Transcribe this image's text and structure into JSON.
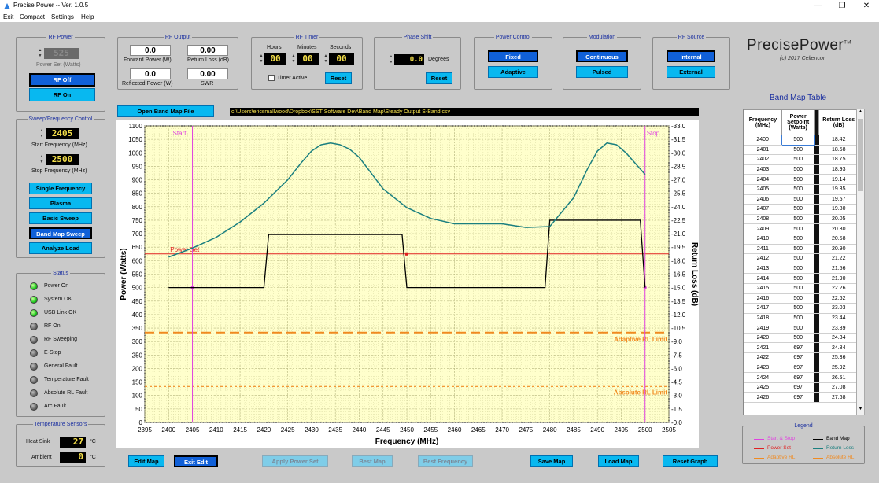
{
  "window": {
    "title": "Precise Power -- Ver. 1.0.5",
    "minimize": "—",
    "restore": "❐",
    "close": "✕"
  },
  "menu": [
    "Exit",
    "Compact",
    "Settings",
    "Help"
  ],
  "rf_power": {
    "title": "RF Power",
    "value": "525",
    "label": "Power Set (Watts)",
    "off": "RF Off",
    "on": "RF On"
  },
  "rf_output": {
    "title": "RF Output",
    "forward": "0.0",
    "forward_label": "Forward Power (W)",
    "return_loss": "0.00",
    "return_loss_label": "Return Loss (dB)",
    "reflected": "0.0",
    "reflected_label": "Reflected Power (W)",
    "swr": "0.00",
    "swr_label": "SWR"
  },
  "rf_timer": {
    "title": "RF Timer",
    "hours_label": "Hours",
    "minutes_label": "Minutes",
    "seconds_label": "Seconds",
    "hours": "00",
    "minutes": "00",
    "seconds": "00",
    "active_label": "Timer Active",
    "reset": "Reset"
  },
  "phase_shift": {
    "title": "Phase Shift",
    "value": "0.0",
    "unit": "Degrees",
    "reset": "Reset"
  },
  "power_control": {
    "title": "Power Control",
    "fixed": "Fixed",
    "adaptive": "Adaptive"
  },
  "modulation": {
    "title": "Modulation",
    "continuous": "Continuous",
    "pulsed": "Pulsed"
  },
  "rf_source": {
    "title": "RF Source",
    "internal": "Internal",
    "external": "External"
  },
  "brand": {
    "name": "PrecisePower",
    "tm": "TM",
    "copyright": "(c)  2017 Cellencor"
  },
  "sweep": {
    "title": "Sweep/Frequency Control",
    "start": "2405",
    "start_label": "Start Frequency (MHz)",
    "stop": "2500",
    "stop_label": "Stop Frequency (MHz)",
    "modes": [
      "Single Frequency",
      "Plasma",
      "Basic Sweep",
      "Band Map Sweep",
      "Analyze Load"
    ],
    "selected": 3
  },
  "status": {
    "title": "Status",
    "items": [
      {
        "label": "Power On",
        "on": true
      },
      {
        "label": "System OK",
        "on": true
      },
      {
        "label": "USB Link OK",
        "on": true
      },
      {
        "label": "RF On",
        "on": false
      },
      {
        "label": "RF Sweeping",
        "on": false
      },
      {
        "label": "E-Stop",
        "on": false
      },
      {
        "label": "General Fault",
        "on": false
      },
      {
        "label": "Temperature Fault",
        "on": false
      },
      {
        "label": "Absolute RL Fault",
        "on": false
      },
      {
        "label": "Arc Fault",
        "on": false
      }
    ]
  },
  "temperature": {
    "title": "Temperature Sensors",
    "heat_sink_label": "Heat Sink",
    "heat_sink": "27",
    "ambient_label": "Ambient",
    "ambient": "0",
    "unit": "°C"
  },
  "band_map": {
    "open_button": "Open Band Map File",
    "path": "c:\\Users\\ericsmallwood\\Dropbox\\SST Software Dev\\Band Map\\Steady Output S-Band.csv"
  },
  "bottom_buttons": [
    {
      "label": "Edit Map",
      "enabled": true,
      "selected": false
    },
    {
      "label": "Exit Edit",
      "enabled": true,
      "selected": true
    },
    {
      "label": "Apply Power Set",
      "enabled": false,
      "selected": false
    },
    {
      "label": "Best Map",
      "enabled": false,
      "selected": false
    },
    {
      "label": "Best Frequency",
      "enabled": false,
      "selected": false
    },
    {
      "label": "Save Map",
      "enabled": true,
      "selected": false
    },
    {
      "label": "Load Map",
      "enabled": true,
      "selected": false
    },
    {
      "label": "Reset Graph",
      "enabled": true,
      "selected": false
    }
  ],
  "table": {
    "title": "Band Map Table",
    "headers": [
      "Frequency (MHz)",
      "Power Setpoint (Watts)",
      "Return Loss (dB)"
    ],
    "rows": [
      [
        "2400",
        "500",
        "18.42"
      ],
      [
        "2401",
        "500",
        "18.58"
      ],
      [
        "2402",
        "500",
        "18.75"
      ],
      [
        "2403",
        "500",
        "18.93"
      ],
      [
        "2404",
        "500",
        "19.14"
      ],
      [
        "2405",
        "500",
        "19.35"
      ],
      [
        "2406",
        "500",
        "19.57"
      ],
      [
        "2407",
        "500",
        "19.80"
      ],
      [
        "2408",
        "500",
        "20.05"
      ],
      [
        "2409",
        "500",
        "20.30"
      ],
      [
        "2410",
        "500",
        "20.58"
      ],
      [
        "2411",
        "500",
        "20.90"
      ],
      [
        "2412",
        "500",
        "21.22"
      ],
      [
        "2413",
        "500",
        "21.56"
      ],
      [
        "2414",
        "500",
        "21.90"
      ],
      [
        "2415",
        "500",
        "22.26"
      ],
      [
        "2416",
        "500",
        "22.62"
      ],
      [
        "2417",
        "500",
        "23.03"
      ],
      [
        "2418",
        "500",
        "23.44"
      ],
      [
        "2419",
        "500",
        "23.89"
      ],
      [
        "2420",
        "500",
        "24.34"
      ],
      [
        "2421",
        "697",
        "24.84"
      ],
      [
        "2422",
        "697",
        "25.36"
      ],
      [
        "2423",
        "697",
        "25.92"
      ],
      [
        "2424",
        "697",
        "26.51"
      ],
      [
        "2425",
        "697",
        "27.08"
      ],
      [
        "2426",
        "697",
        "27.68"
      ]
    ]
  },
  "legend": {
    "title": "Legend",
    "items": [
      {
        "label": "Start & Stop",
        "color": "#e040e0"
      },
      {
        "label": "Band Map",
        "color": "#000000"
      },
      {
        "label": "Power Set",
        "color": "#e02020"
      },
      {
        "label": "Return Loss",
        "color": "#1a7f7f"
      },
      {
        "label": "Adaptive RL",
        "color": "#f08a20"
      },
      {
        "label": "Absolute RL",
        "color": "#f08a20"
      }
    ]
  },
  "chart_data": {
    "type": "line",
    "xlabel": "Frequency (MHz)",
    "ylabel": "Power (Watts)",
    "y2label": "Return Loss (dB)",
    "xlim": [
      2395,
      2505
    ],
    "ylim": [
      0,
      1100
    ],
    "y2lim": [
      0,
      33
    ],
    "xticks": [
      2395,
      2400,
      2405,
      2410,
      2415,
      2420,
      2425,
      2430,
      2435,
      2440,
      2445,
      2450,
      2455,
      2460,
      2465,
      2470,
      2475,
      2480,
      2485,
      2490,
      2495,
      2500,
      2505
    ],
    "yticks": [
      0,
      50,
      100,
      150,
      200,
      250,
      300,
      350,
      400,
      450,
      500,
      550,
      600,
      650,
      700,
      750,
      800,
      850,
      900,
      950,
      1000,
      1050,
      1100
    ],
    "y2ticks": [
      "-0.0",
      "-1.5",
      "-3.0",
      "-4.5",
      "-6.0",
      "-7.5",
      "-9.0",
      "-10.5",
      "-12.0",
      "-13.5",
      "-15.0",
      "-16.5",
      "-18.0",
      "-19.5",
      "-21.0",
      "-22.5",
      "-24.0",
      "-25.5",
      "-27.0",
      "-28.5",
      "-30.0",
      "-31.5",
      "-33.0"
    ],
    "grid": true,
    "start": {
      "x": 2405,
      "label": "Start"
    },
    "stop": {
      "x": 2500,
      "label": "Stop"
    },
    "power_set": {
      "y": 625,
      "label": "Power Set",
      "marker_x": 2450
    },
    "adaptive_rl": {
      "y": 10,
      "label": "Adaptive RL Limit"
    },
    "absolute_rl": {
      "y": 4,
      "label": "Absolute RL Limit"
    },
    "band_map": {
      "name": "Band Map",
      "x": [
        2400,
        2420,
        2421,
        2449,
        2450,
        2479,
        2480,
        2499,
        2500
      ],
      "y": [
        500,
        500,
        697,
        697,
        500,
        500,
        750,
        750,
        500
      ]
    },
    "return_loss": {
      "name": "Return Loss",
      "x": [
        2400,
        2405,
        2410,
        2415,
        2420,
        2425,
        2428,
        2430,
        2432,
        2434,
        2436,
        2438,
        2440,
        2442,
        2445,
        2450,
        2455,
        2460,
        2465,
        2470,
        2475,
        2480,
        2485,
        2488,
        2490,
        2492,
        2494,
        2496,
        2498,
        2500
      ],
      "y": [
        18.4,
        19.4,
        20.6,
        22.3,
        24.4,
        27.0,
        29.0,
        30.2,
        30.9,
        31.1,
        30.9,
        30.4,
        29.5,
        28.1,
        26.0,
        23.9,
        22.7,
        22.1,
        22.1,
        22.1,
        21.7,
        21.8,
        25.0,
        28.3,
        30.2,
        31.1,
        30.9,
        30.0,
        28.8,
        27.6
      ]
    }
  }
}
